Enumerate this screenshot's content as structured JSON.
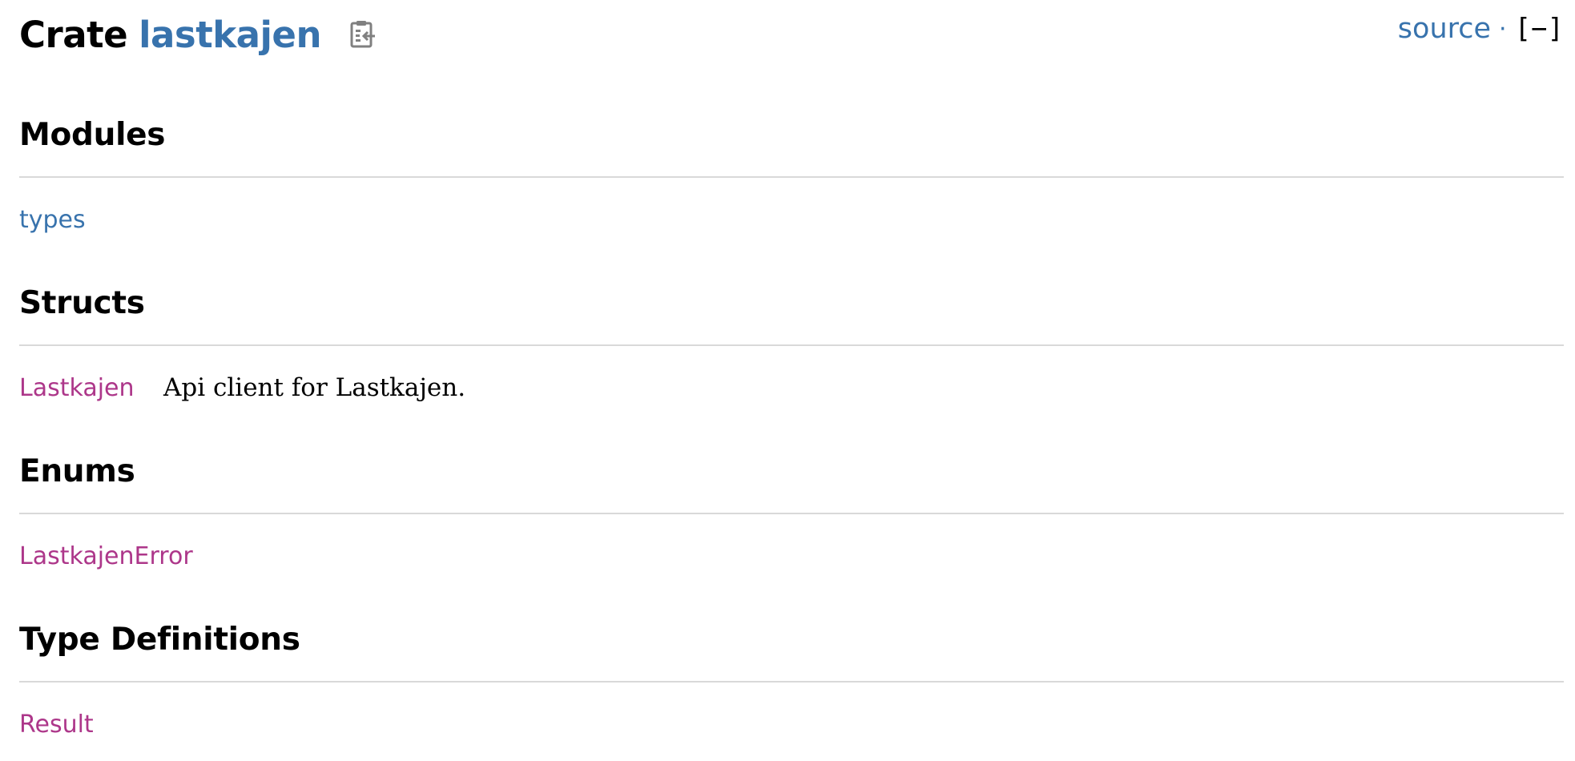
{
  "header": {
    "crate_word": "Crate",
    "crate_name": "lastkajen",
    "copy_icon": "clipboard-icon",
    "source_label": "source",
    "separator": "·",
    "toggle_label": "[−]"
  },
  "sections": {
    "modules": {
      "title": "Modules",
      "items": [
        {
          "name": "types",
          "description": ""
        }
      ]
    },
    "structs": {
      "title": "Structs",
      "items": [
        {
          "name": "Lastkajen",
          "description": "Api client for Lastkajen."
        }
      ]
    },
    "enums": {
      "title": "Enums",
      "items": [
        {
          "name": "LastkajenError",
          "description": ""
        }
      ]
    },
    "type_definitions": {
      "title": "Type Definitions",
      "items": [
        {
          "name": "Result",
          "description": ""
        }
      ]
    }
  },
  "colors": {
    "link_module": "#3873ad",
    "link_type": "#ad378a",
    "rule": "#d9d9d9",
    "text": "#000000"
  }
}
